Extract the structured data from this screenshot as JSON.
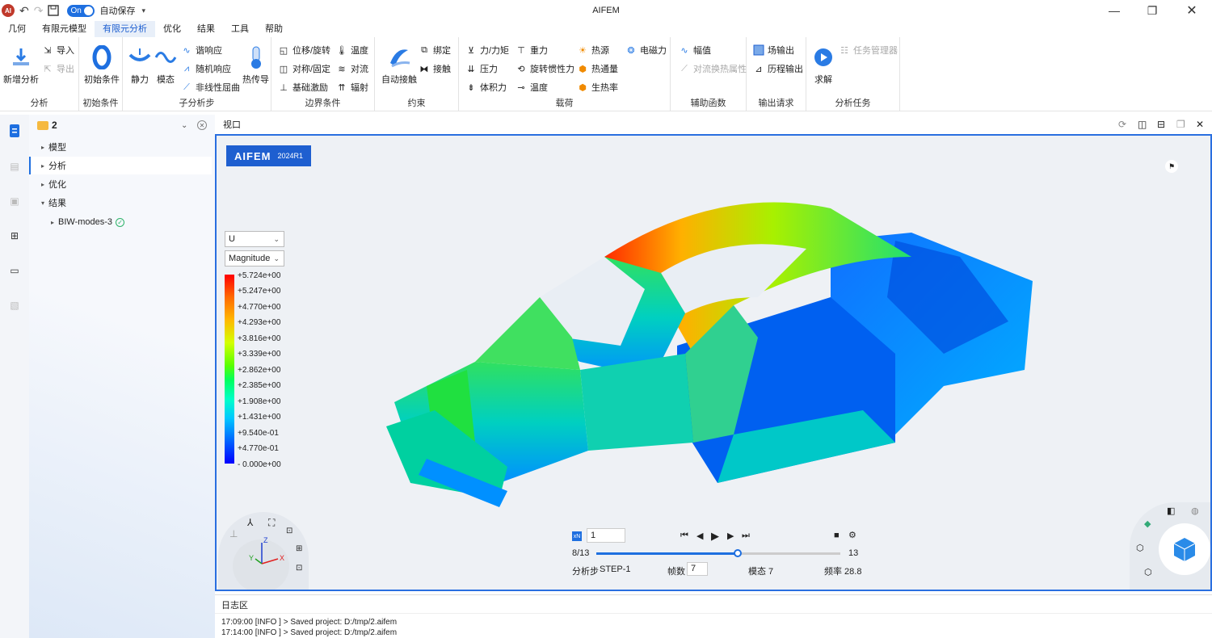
{
  "app": {
    "title": "AIFEM",
    "autosave_toggle": "On",
    "autosave_label": "自动保存"
  },
  "menu": [
    "几何",
    "有限元模型",
    "有限元分析",
    "优化",
    "结果",
    "工具",
    "帮助"
  ],
  "ribbon": {
    "groups": {
      "analysis": "分析",
      "init": "初始条件",
      "substep": "子分析步",
      "bc": "边界条件",
      "constraint": "约束",
      "load": "载荷",
      "aux": "辅助函数",
      "output": "输出请求",
      "task": "分析任务"
    },
    "new_analysis": "新增分析",
    "import": "导入",
    "export": "导出",
    "init_cond": "初始条件",
    "static": "静力",
    "modal": "模态",
    "harmonic": "谐响应",
    "random": "随机响应",
    "nonlinear_buckling": "非线性屈曲",
    "heat_transfer": "热传导",
    "disp_rot": "位移/旋转",
    "sym_fixed": "对称/固定",
    "base_excitation": "基础激励",
    "temperature_bc": "温度",
    "convection": "对流",
    "radiation": "辐射",
    "auto_contact": "自动接触",
    "tie": "绑定",
    "contact": "接触",
    "force_moment": "力/力矩",
    "pressure": "压力",
    "body_force": "体积力",
    "gravity": "重力",
    "rot_inertia": "旋转惯性力",
    "temperature_load": "温度",
    "heat_source": "热源",
    "heat_flux": "热通量",
    "heat_gen": "生热率",
    "electromagnetic": "电磁力",
    "amplitude": "幅值",
    "conv_heat_prop": "对流换热属性",
    "field_output": "场输出",
    "history_output": "历程输出",
    "solve": "求解",
    "task_manager": "任务管理器"
  },
  "tree": {
    "root": "2",
    "items": [
      {
        "label": "模型"
      },
      {
        "label": "分析"
      },
      {
        "label": "优化"
      },
      {
        "label": "结果"
      },
      {
        "label": "BIW-modes-3"
      }
    ]
  },
  "viewport": {
    "title": "视口",
    "logo": "AIFEM",
    "version": "2024R1",
    "variable": "U",
    "component": "Magnitude",
    "legend": [
      "+5.724e+00",
      "+5.247e+00",
      "+4.770e+00",
      "+4.293e+00",
      "+3.816e+00",
      "+3.339e+00",
      "+2.862e+00",
      "+2.385e+00",
      "+1.908e+00",
      "+1.431e+00",
      "+9.540e-01",
      "+4.770e-01",
      "- 0.000e+00"
    ],
    "triad": {
      "x": "X",
      "y": "Y",
      "z": "Z"
    },
    "anim": {
      "scale": "1",
      "frame_pos": "8/13",
      "frame_end": "13",
      "progress": 0.58,
      "step_label": "分析步",
      "step": "STEP-1",
      "frames_label": "帧数",
      "frames": "7",
      "mode": "模态 7",
      "freq": "频率 28.8"
    }
  },
  "log": {
    "title": "日志区",
    "lines": [
      "17:09:00 [INFO ] > Saved project: D:/tmp/2.aifem",
      "17:14:00 [INFO ] > Saved project: D:/tmp/2.aifem"
    ]
  }
}
